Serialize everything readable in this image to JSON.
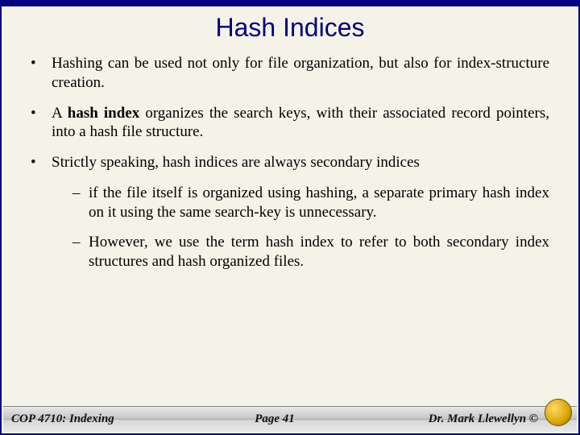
{
  "title": "Hash Indices",
  "bullets": {
    "b1": "Hashing can be used not only for file organization, but also for index-structure creation.",
    "b2_pre": "A ",
    "b2_bold": "hash index",
    "b2_post": " organizes the search keys, with their associated record pointers, into a hash file structure.",
    "b3": "Strictly speaking, hash indices are always secondary indices",
    "s1": "if the file itself is organized using hashing, a separate primary hash index on it using the same search-key is unnecessary.",
    "s2": "However, we use the term hash index to refer to both secondary index structures and hash organized files."
  },
  "footer": {
    "left": "COP 4710: Indexing",
    "mid": "Page 41",
    "right": "Dr. Mark Llewellyn ©"
  }
}
